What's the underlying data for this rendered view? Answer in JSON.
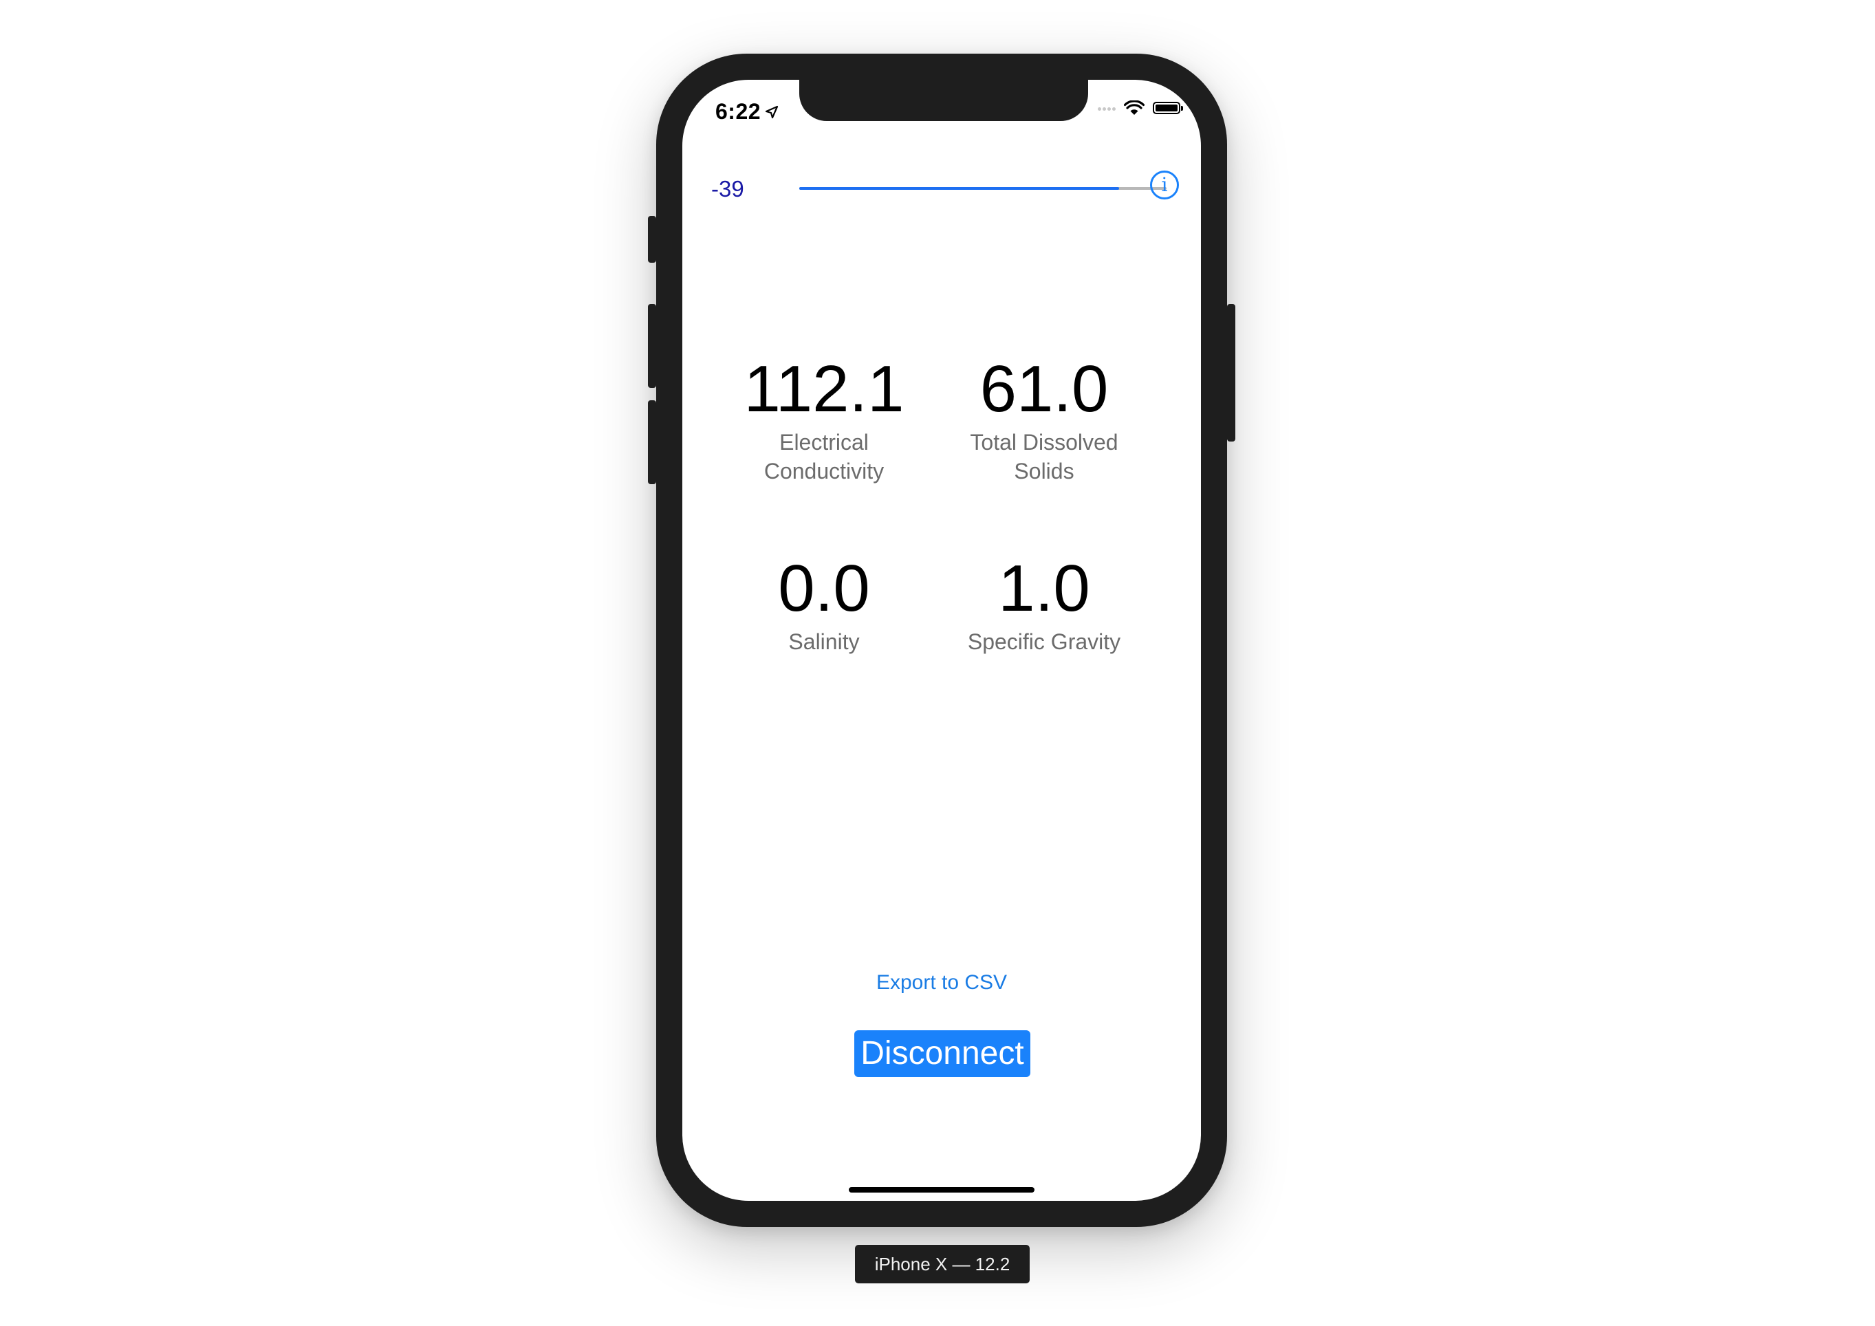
{
  "status_bar": {
    "time": "6:22",
    "location_icon": "location-arrow-icon",
    "wifi_icon": "wifi-icon",
    "battery_icon": "battery-icon"
  },
  "rssi": {
    "value": "-39",
    "level_fraction": 0.87,
    "info_icon": "info-circle-icon",
    "info_glyph": "i"
  },
  "metrics": [
    {
      "value": "112.1",
      "label": "Electrical\nConductivity"
    },
    {
      "value": "61.0",
      "label": "Total Dissolved\nSolids"
    },
    {
      "value": "0.0",
      "label": "Salinity"
    },
    {
      "value": "1.0",
      "label": "Specific Gravity"
    }
  ],
  "actions": {
    "export_label": "Export to CSV",
    "disconnect_label": "Disconnect"
  },
  "device_caption": "iPhone X — 12.2",
  "colors": {
    "accent": "#1a82fb",
    "rssi_text": "#1a1aa6",
    "label_gray": "#6b6b6b",
    "device_frame": "#1e1e1e"
  }
}
